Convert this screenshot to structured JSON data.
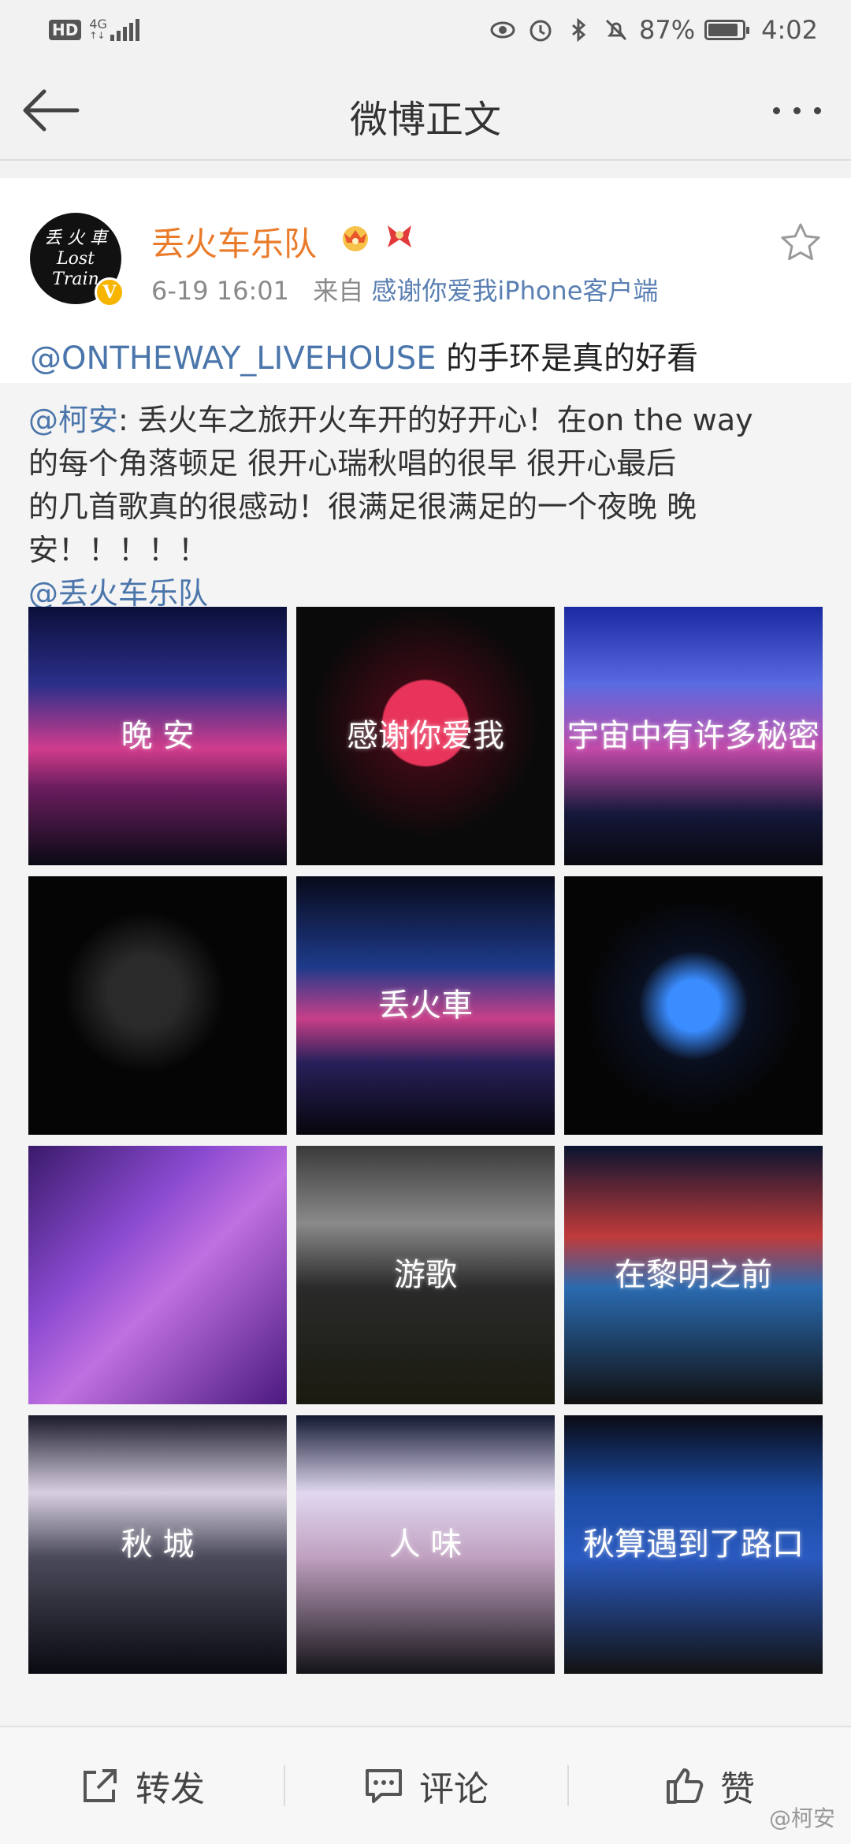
{
  "status_bar": {
    "hd": "HD",
    "network": "4G",
    "battery_percent": "87%",
    "battery_level": 0.87,
    "time": "4:02",
    "icons": [
      "eye-icon",
      "alarm-icon",
      "bluetooth-icon",
      "mute-icon"
    ]
  },
  "nav": {
    "title": "微博正文",
    "back_icon": "back-arrow-icon",
    "more_icon": "more-dots-icon"
  },
  "post": {
    "author": "丢火车乐队",
    "avatar_text": "丢 火 車 Lost Train",
    "verified": true,
    "time": "6-19 16:01",
    "source_prefix": "来自",
    "source": "感谢你爱我iPhone客户端",
    "text_mention": "@ONTHEWAY_LIVEHOUSE",
    "text_body": " 的手环是真的好看"
  },
  "repost": {
    "mention": "@柯安",
    "lines": [
      ": 丢火车之旅开火车开的好开心！在on the way",
      "的每个角落顿足 很开心瑞秋唱的很早 很开心最后",
      "的几首歌真的很感动！很满足很满足的一个夜晚 晚",
      "安！！！！！"
    ],
    "tail_mention": "@丢火车乐队",
    "images": [
      {
        "caption": "晚 安",
        "bg": "linear-gradient(180deg,#0b0f3a 0%,#2b2f8a 30%,#d13c8c 55%,#6a1d5e 70%,#0a0a14 100%)"
      },
      {
        "caption": "感谢你爱我",
        "bg": "radial-gradient(circle at 50% 45%,#e8335a 0 22%,#3a0a14 23%,#0a0a0a 60%)"
      },
      {
        "caption": "宇宙中有许多秘密",
        "bg": "linear-gradient(180deg,#1a2aa0 0%,#5a6ae0 30%,#c24aa8 55%,#15183a 80%,#08080f 100%)"
      },
      {
        "caption": "",
        "bg": "radial-gradient(circle at 45% 45%,#2a2a2a 0 18%,#050505 40%)"
      },
      {
        "caption": "丢火車",
        "bg": "linear-gradient(180deg,#080a1a 0%,#1e3a8a 35%,#c73f88 55%,#28205a 72%,#06060c 100%)"
      },
      {
        "caption": "",
        "bg": "radial-gradient(circle at 50% 50%,#3a8cff 0 14%,#0a1020 30%,#050505 60%)"
      },
      {
        "caption": "",
        "bg": "linear-gradient(135deg,#3a1a6a 0%,#8a4ad0 35%,#c070e0 55%,#4a1a80 100%)"
      },
      {
        "caption": "游歌",
        "bg": "linear-gradient(180deg,#3a3a3a 0%,#8a8a8a 30%,#2a2a2a 55%,#1a1a10 100%)"
      },
      {
        "caption": "在黎明之前",
        "bg": "linear-gradient(180deg,#0a1430 0%,#c03a3a 35%,#2a6ab0 55%,#101010 100%)"
      },
      {
        "caption": "秋 城",
        "bg": "linear-gradient(180deg,#1a1a2a 0%,#d8d0e0 30%,#4a4a5a 55%,#0a0a12 100%)"
      },
      {
        "caption": "人 味",
        "bg": "linear-gradient(180deg,#101830 0%,#e0d8f0 30%,#c0a0c0 55%,#141418 100%)"
      },
      {
        "caption": "秋算遇到了路口",
        "bg": "linear-gradient(180deg,#0a0a14 0%,#1a4aa0 30%,#2a5ac0 55%,#121212 100%)"
      }
    ]
  },
  "actions": {
    "repost_label": "转发",
    "comment_label": "评论",
    "like_label": "赞",
    "watermark": "@柯安"
  },
  "colors": {
    "author": "#ea7b2a",
    "link": "#4b76ab",
    "verify": "#f7b500"
  }
}
